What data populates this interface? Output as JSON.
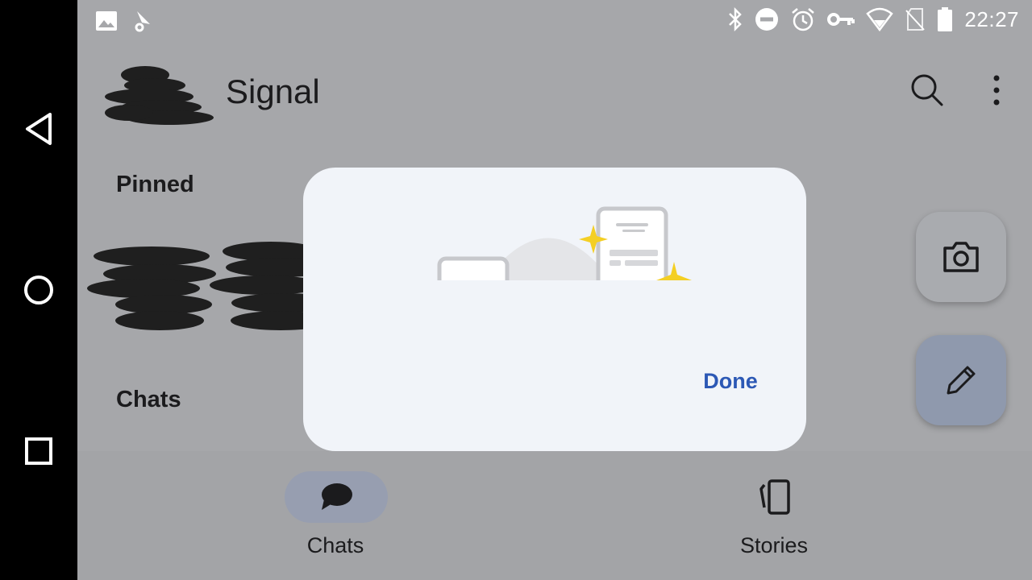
{
  "statusbar": {
    "time": "22:27",
    "icons": [
      "image-icon",
      "location-pin-icon",
      "bluetooth-icon",
      "do-not-disturb-icon",
      "alarm-icon",
      "vpn-key-icon",
      "wifi-icon",
      "no-sim-icon",
      "battery-icon"
    ]
  },
  "header": {
    "title": "Signal",
    "search_icon": "search-icon",
    "more_icon": "more-vertical-icon"
  },
  "sections": {
    "pinned": "Pinned",
    "chats": "Chats"
  },
  "fabs": {
    "camera_icon": "camera-icon",
    "compose_icon": "pencil-icon"
  },
  "bottom_nav": {
    "items": [
      {
        "label": "Chats",
        "icon": "chat-bubble-icon",
        "selected": true
      },
      {
        "label": "Stories",
        "icon": "stories-icon",
        "selected": false
      }
    ]
  },
  "dialog": {
    "done_label": "Done"
  },
  "system_nav": {
    "icons": [
      "back-icon",
      "home-icon",
      "recents-icon"
    ]
  },
  "colors": {
    "accent": "#2c58b5",
    "scrim_background": "#a6a7aa",
    "dialog_background": "#f1f4f9",
    "sparkle": "#f4cf24"
  }
}
